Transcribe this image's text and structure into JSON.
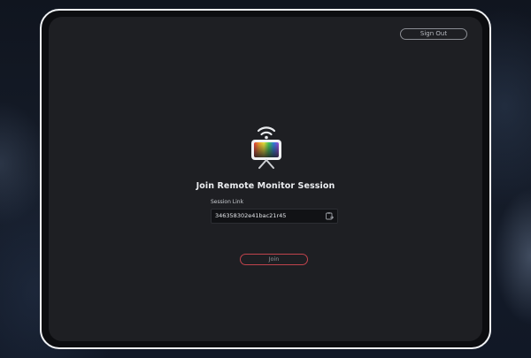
{
  "header": {
    "sign_out_label": "Sign Out"
  },
  "main": {
    "title": "Join Remote Monitor Session",
    "session_link": {
      "label": "Session Link",
      "value": "346358302e41bac21r45"
    },
    "join_label": "Join"
  },
  "icons": {
    "app_icon": "remote-monitor-icon",
    "copy_icon": "paste-icon"
  },
  "colors": {
    "join_border": "#c0434c",
    "panel_background": "#1e1f23",
    "device_frame": "#f2f4f7"
  }
}
